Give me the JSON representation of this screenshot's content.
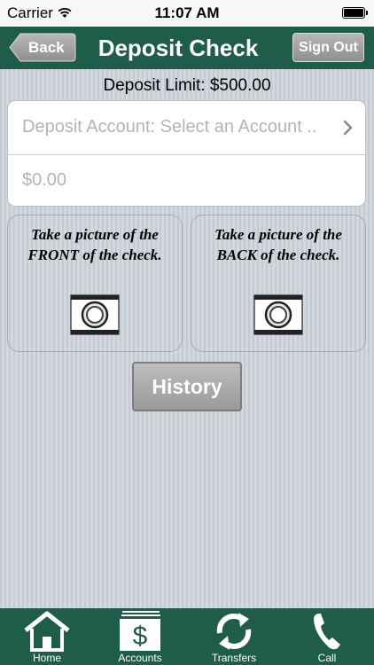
{
  "status_bar": {
    "carrier": "Carrier",
    "time": "11:07 AM"
  },
  "nav": {
    "back_label": "Back",
    "title": "Deposit Check",
    "signout_label": "Sign Out"
  },
  "deposit_limit": "Deposit Limit: $500.00",
  "form": {
    "account_placeholder": "Deposit Account: Select an Account ..",
    "amount_placeholder": "$0.00"
  },
  "photos": {
    "front_text": "Take a picture of the FRONT of the check.",
    "back_text": "Take a picture of the BACK of the check."
  },
  "history_label": "History",
  "tabs": [
    {
      "label": "Home",
      "icon": "home-icon"
    },
    {
      "label": "Accounts",
      "icon": "dollar-icon"
    },
    {
      "label": "Transfers",
      "icon": "refresh-icon"
    },
    {
      "label": "Call",
      "icon": "phone-icon"
    }
  ],
  "colors": {
    "brand_green": "#1f5d4b",
    "button_gray": "#a6a6a6"
  }
}
